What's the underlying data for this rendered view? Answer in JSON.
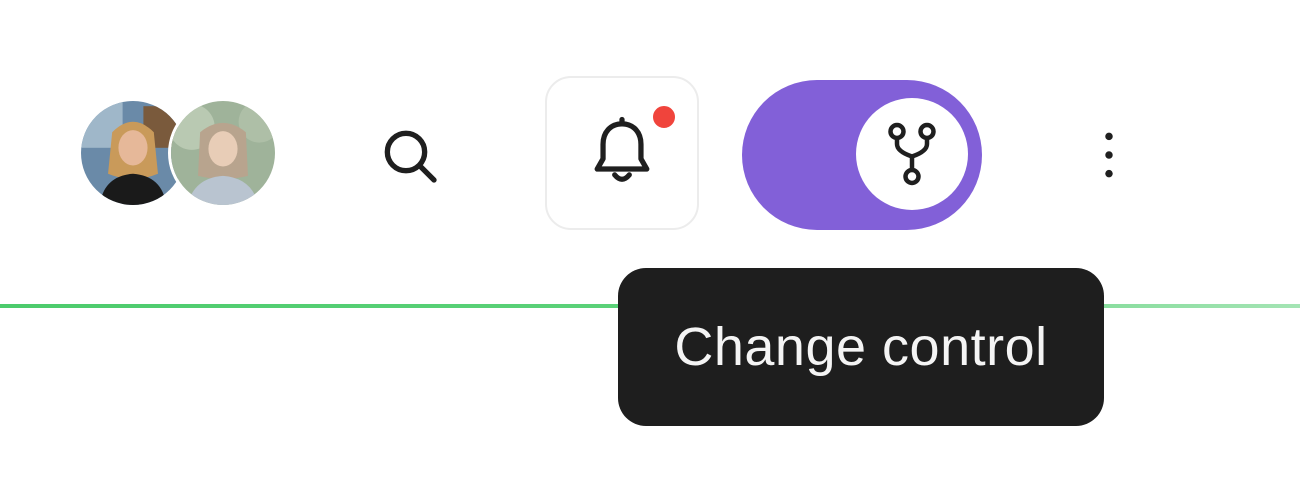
{
  "header": {
    "avatars": [
      {
        "name": "avatar-user-1"
      },
      {
        "name": "avatar-user-2"
      }
    ],
    "search": {
      "icon": "search-icon"
    },
    "notifications": {
      "icon": "bell-icon",
      "has_unread": true,
      "dot_color": "#f0443c"
    },
    "change_control_toggle": {
      "icon": "git-branch-icon",
      "state": "on",
      "color": "#8260d8"
    },
    "more": {
      "icon": "more-vertical-icon"
    }
  },
  "progress": {
    "value": 1.0,
    "color": "#4ccb6c"
  },
  "tooltip": {
    "text": "Change control"
  }
}
